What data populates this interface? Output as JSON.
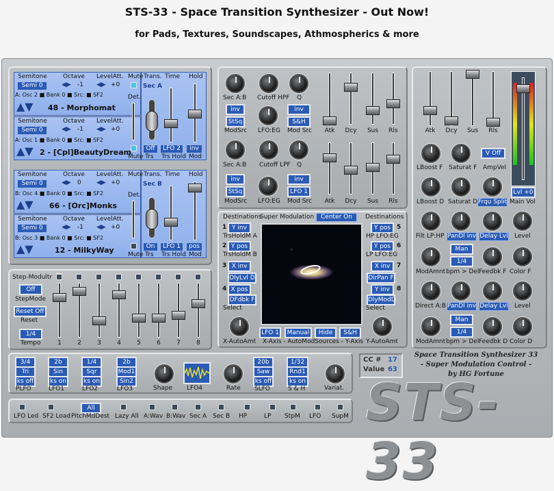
{
  "header": {
    "title": "STS-33 - Space Transition Synthesizer - Out Now!",
    "subtitle": "for Pads, Textures, Soundscapes, Athmospherics & more"
  },
  "osc_headers": {
    "semitone": "Semitone",
    "octave": "Octave",
    "level": "LevelAtt.",
    "mute": "Mute",
    "trans": "Trans.",
    "time": "Time",
    "hold": "Hold",
    "det": "Det."
  },
  "oscA1": {
    "semi": "Semi 0",
    "oct": "-1",
    "lvl": "+0",
    "bank": "A: Osc 2",
    "bankv": "Bank",
    "bankn": "0",
    "src": "Src:",
    "sf": "SF2",
    "name": "48 - Morphomat"
  },
  "oscA2": {
    "semi": "Semi 0",
    "oct": "-1",
    "lvl": "+0",
    "bank": "A: Osc 1",
    "bankv": "Bank",
    "bankn": "0",
    "src": "Src:",
    "sf": "SF2",
    "name": "2 - [Cpl]BeautyDream"
  },
  "secA": {
    "label": "Sec A",
    "off": "Off",
    "lfo": "LFO 2",
    "inv": "inv",
    "trs": "Trs",
    "trshold": "Trs Hold",
    "mod": "Mod",
    "mute": "Mute"
  },
  "oscB1": {
    "semi": "Semi 0",
    "oct": "0",
    "lvl": "+0",
    "bank": "B: Osc 4",
    "bankv": "Bank",
    "bankn": "0",
    "src": "Src:",
    "sf": "SF2",
    "name": "66 - [Orc]Monks"
  },
  "oscB2": {
    "semi": "Semi 0",
    "oct": "-1",
    "lvl": "+0",
    "bank": "B: Osc 3",
    "bankv": "Bank",
    "bankn": "0",
    "src": "Src:",
    "sf": "SF2",
    "name": "12 - MilkyWay"
  },
  "secB": {
    "label": "Sec B",
    "on": "On",
    "lfo": "LFO 1",
    "pos": "pos",
    "trs": "Trs",
    "trshold": "Trs Hold",
    "mod": "Mod",
    "mute": "Mute"
  },
  "step": {
    "title": "Step-Modultr",
    "off": "Off",
    "mode": "StepMode",
    "reset_off": "Reset Off",
    "reset": "Reset",
    "tempo_val": "1/4",
    "tempo": "Tempo",
    "steps": [
      "1",
      "2",
      "3",
      "4",
      "5",
      "6",
      "7",
      "8"
    ]
  },
  "filt1": {
    "k1": "Sec A:B",
    "k2": "Cutoff HPF",
    "k3": "Q",
    "inv1": "inv",
    "stsq": "StSq",
    "modsrc": "ModSrc",
    "lfoeg": "LFO:EG",
    "inv2": "inv",
    "sh": "S&H",
    "modsrc2": "Mod Src",
    "adsr": [
      "Atk",
      "Dcy",
      "Sus",
      "Rls"
    ]
  },
  "filt2": {
    "k1": "Sec A:B",
    "k2": "Cutoff LPF",
    "k3": "Q",
    "inv1": "inv",
    "stsq": "StSq",
    "modsrc": "ModSrc",
    "lfoeg": "LFO:EG",
    "lfo1": "LFO 1",
    "modsrc2": "Mod Src",
    "adsr": [
      "Atk",
      "Dcy",
      "Sus",
      "Rls"
    ]
  },
  "supermod": {
    "dest_l": "Destinations",
    "title": "Super Modulation",
    "center": "Center On",
    "dest_r": "Destinations",
    "left": [
      {
        "n": "1",
        "b": "Y inv",
        "l": "TrsHoldM A"
      },
      {
        "n": "2",
        "b": "Y pos",
        "l": "TrsHoldM B"
      },
      {
        "n": "3",
        "b": "X inv",
        "l": ""
      },
      {
        "n": "",
        "b": "DlyLvl D",
        "l": ""
      },
      {
        "n": "4",
        "b": "X pos",
        "l": ""
      },
      {
        "n": "",
        "b": "DFdbk F",
        "l": "Select"
      }
    ],
    "right": [
      {
        "n": "5",
        "b": "Y pos",
        "l": "HP LFO:EG"
      },
      {
        "n": "6",
        "b": "Y pos",
        "l": "LP LFO:EG"
      },
      {
        "n": "7",
        "b": "X inv",
        "l": ""
      },
      {
        "n": "",
        "b": "DirPan F",
        "l": ""
      },
      {
        "n": "8",
        "b": "Y inv",
        "l": ""
      },
      {
        "n": "",
        "b": "DlyModD",
        "l": "Select"
      }
    ],
    "lfo1": "LFO 1",
    "manual": "Manual",
    "hide": "Hide",
    "sh": "S&H",
    "xauto": "X-AutoAmt",
    "xaxis": "X-Axis - AutoModSources - Y-Axis",
    "yauto": "Y-AutoAmt"
  },
  "amp": {
    "adsr": [
      "Atk",
      "Dcy",
      "Sus",
      "Rls"
    ],
    "lboostf": "LBoost F",
    "saturatf": "Saturat F",
    "voff": "V Off",
    "ampvel": "AmpVel",
    "lboostd": "LBoost D",
    "saturatd": "Saturat D",
    "frqu": "Frqu Split",
    "lvl": "Lvl +0",
    "mainvol": "Main Vol"
  },
  "fx": {
    "filtlp": "Filt LP:HP",
    "pandl1": "PanDl inv",
    "delaylvl1": "Delay Lvl",
    "level1": "Level",
    "man1": "Man",
    "q1": "1/4",
    "modamt1": "ModAmnt",
    "bpm1": "bpm > Del",
    "feedbk1": "Feedbk F",
    "color1": "Color F",
    "direct": "Direct A:B",
    "pandl2": "PanDl inv",
    "delaylvl2": "Delay Lvl",
    "level2": "Level",
    "man2": "Man",
    "q2": "1/4",
    "modamt2": "ModAmnt",
    "bpm2": "bpm > Del",
    "feedbk2": "Feedbk D",
    "color2": "Color D"
  },
  "lfos": [
    {
      "top": "3/4",
      "mid": "Tri",
      "bot": "ks off",
      "lbl": "PLFO"
    },
    {
      "top": "2b",
      "mid": "Sin",
      "bot": "ks on",
      "lbl": "LFO1"
    },
    {
      "top": "1/4",
      "mid": "Sqr",
      "bot": "ks on",
      "lbl": "LFO2"
    },
    {
      "top": "2b",
      "mid": "Mod1",
      "bot": "Sin2",
      "lbl": "LFO3"
    }
  ],
  "lfo_knobs": {
    "shape": "Shape",
    "lfo4": "LFO4",
    "rate": "Rate",
    "slfo": "SLFO",
    "sh": "S & H",
    "variat": "Variat."
  },
  "slfo": {
    "top": "20b",
    "mid": "Saw",
    "bot": "ks off"
  },
  "sh": {
    "top": "1/32",
    "mid": "Rnd1",
    "bot": "ks on"
  },
  "cc": {
    "cc": "CC #",
    "ccv": "17",
    "val": "Value",
    "valv": "63"
  },
  "credit": [
    "Space Transition Synthesizer 33",
    "- Super Modulation Control -",
    "by HG Fortune"
  ],
  "logo": "STS-33",
  "bottom": [
    {
      "lbl": "LFO Led"
    },
    {
      "lbl": "SF2 Load"
    },
    {
      "lbl": "PitchMdDest",
      "btn": "All"
    },
    {
      "lbl": "Lazy All"
    },
    {
      "lbl": "A:Wav"
    },
    {
      "lbl": "B:Wav"
    },
    {
      "lbl": "Sec A"
    },
    {
      "lbl": "Sec B"
    },
    {
      "lbl": "HP"
    },
    {
      "lbl": "LP"
    },
    {
      "lbl": "StpM"
    },
    {
      "lbl": "LFO"
    },
    {
      "lbl": "SupM"
    }
  ]
}
